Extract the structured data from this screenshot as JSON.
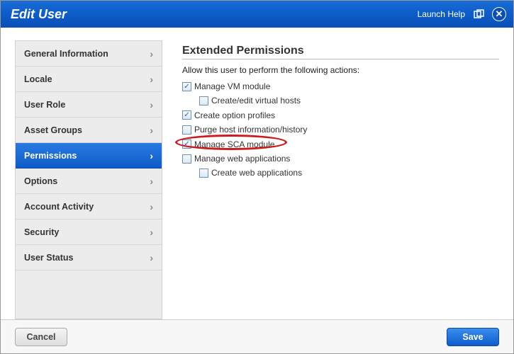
{
  "title": "Edit User",
  "launchHelp": "Launch Help",
  "sidebar": {
    "items": [
      {
        "label": "General Information"
      },
      {
        "label": "Locale"
      },
      {
        "label": "User Role"
      },
      {
        "label": "Asset Groups"
      },
      {
        "label": "Permissions"
      },
      {
        "label": "Options"
      },
      {
        "label": "Account Activity"
      },
      {
        "label": "Security"
      },
      {
        "label": "User Status"
      }
    ],
    "activeIndex": 4
  },
  "content": {
    "heading": "Extended Permissions",
    "description": "Allow this user to perform the following actions:",
    "permissions": [
      {
        "label": "Manage VM module",
        "checked": true,
        "indent": false
      },
      {
        "label": "Create/edit virtual hosts",
        "checked": false,
        "indent": true
      },
      {
        "label": "Create option profiles",
        "checked": true,
        "indent": false
      },
      {
        "label": "Purge host information/history",
        "checked": false,
        "indent": false
      },
      {
        "label": "Manage SCA module",
        "checked": true,
        "indent": false,
        "highlighted": true
      },
      {
        "label": "Manage web applications",
        "checked": false,
        "indent": false
      },
      {
        "label": "Create web applications",
        "checked": false,
        "indent": true
      }
    ]
  },
  "footer": {
    "cancel": "Cancel",
    "save": "Save"
  }
}
